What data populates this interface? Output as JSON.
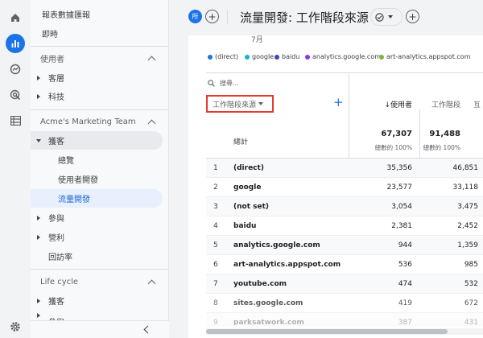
{
  "sidebar": {
    "reports_snapshot": "報表數據匯報",
    "realtime": "即時",
    "user_section": "使用者",
    "user_items": [
      "客層",
      "科技"
    ],
    "team_section": "Acme's Marketing Team",
    "acquisition": "獲客",
    "acq_items": [
      "總覽",
      "使用者開發",
      "流量開發"
    ],
    "engagement": "參與",
    "monetization": "營利",
    "retention": "回訪率",
    "lifecycle_section": "Life cycle",
    "lifecycle_items": [
      "獲客",
      "參與"
    ]
  },
  "topbar": {
    "avatar_label": "所",
    "title": "流量開發: 工作階段來源"
  },
  "chart_partial_label": "7月",
  "legend": [
    {
      "label": "(direct)",
      "color": "#1a73e8"
    },
    {
      "label": "google",
      "color": "#12b5cb"
    },
    {
      "label": "baidu",
      "color": "#3949ab"
    },
    {
      "label": "analytics.google.com",
      "color": "#9334e6"
    },
    {
      "label": "art-analytics.appspot.com",
      "color": "#7cb342"
    }
  ],
  "table": {
    "search_placeholder": "搜尋...",
    "dimension_label": "工作階段來源",
    "col_users": "↓使用者",
    "col_sessions": "工作階段",
    "col_more": "互",
    "total_label": "總計",
    "total_users": "67,307",
    "total_users_pct": "總數的 100%",
    "total_sessions": "91,488",
    "total_sessions_pct": "總數的 100%",
    "rows": [
      {
        "idx": "1",
        "name": "(direct)",
        "users": "35,356",
        "sessions": "46,851"
      },
      {
        "idx": "2",
        "name": "google",
        "users": "23,577",
        "sessions": "33,118"
      },
      {
        "idx": "3",
        "name": "(not set)",
        "users": "3,054",
        "sessions": "3,475"
      },
      {
        "idx": "4",
        "name": "baidu",
        "users": "2,381",
        "sessions": "2,452"
      },
      {
        "idx": "5",
        "name": "analytics.google.com",
        "users": "944",
        "sessions": "1,359"
      },
      {
        "idx": "6",
        "name": "art-analytics.appspot.com",
        "users": "536",
        "sessions": "985"
      },
      {
        "idx": "7",
        "name": "youtube.com",
        "users": "474",
        "sessions": "532"
      },
      {
        "idx": "8",
        "name": "sites.google.com",
        "users": "419",
        "sessions": "672"
      },
      {
        "idx": "9",
        "name": "parksatwork.com",
        "users": "387",
        "sessions": "431"
      }
    ]
  },
  "colors": {
    "accent": "#1a73e8",
    "highlight_border": "#e53935"
  }
}
